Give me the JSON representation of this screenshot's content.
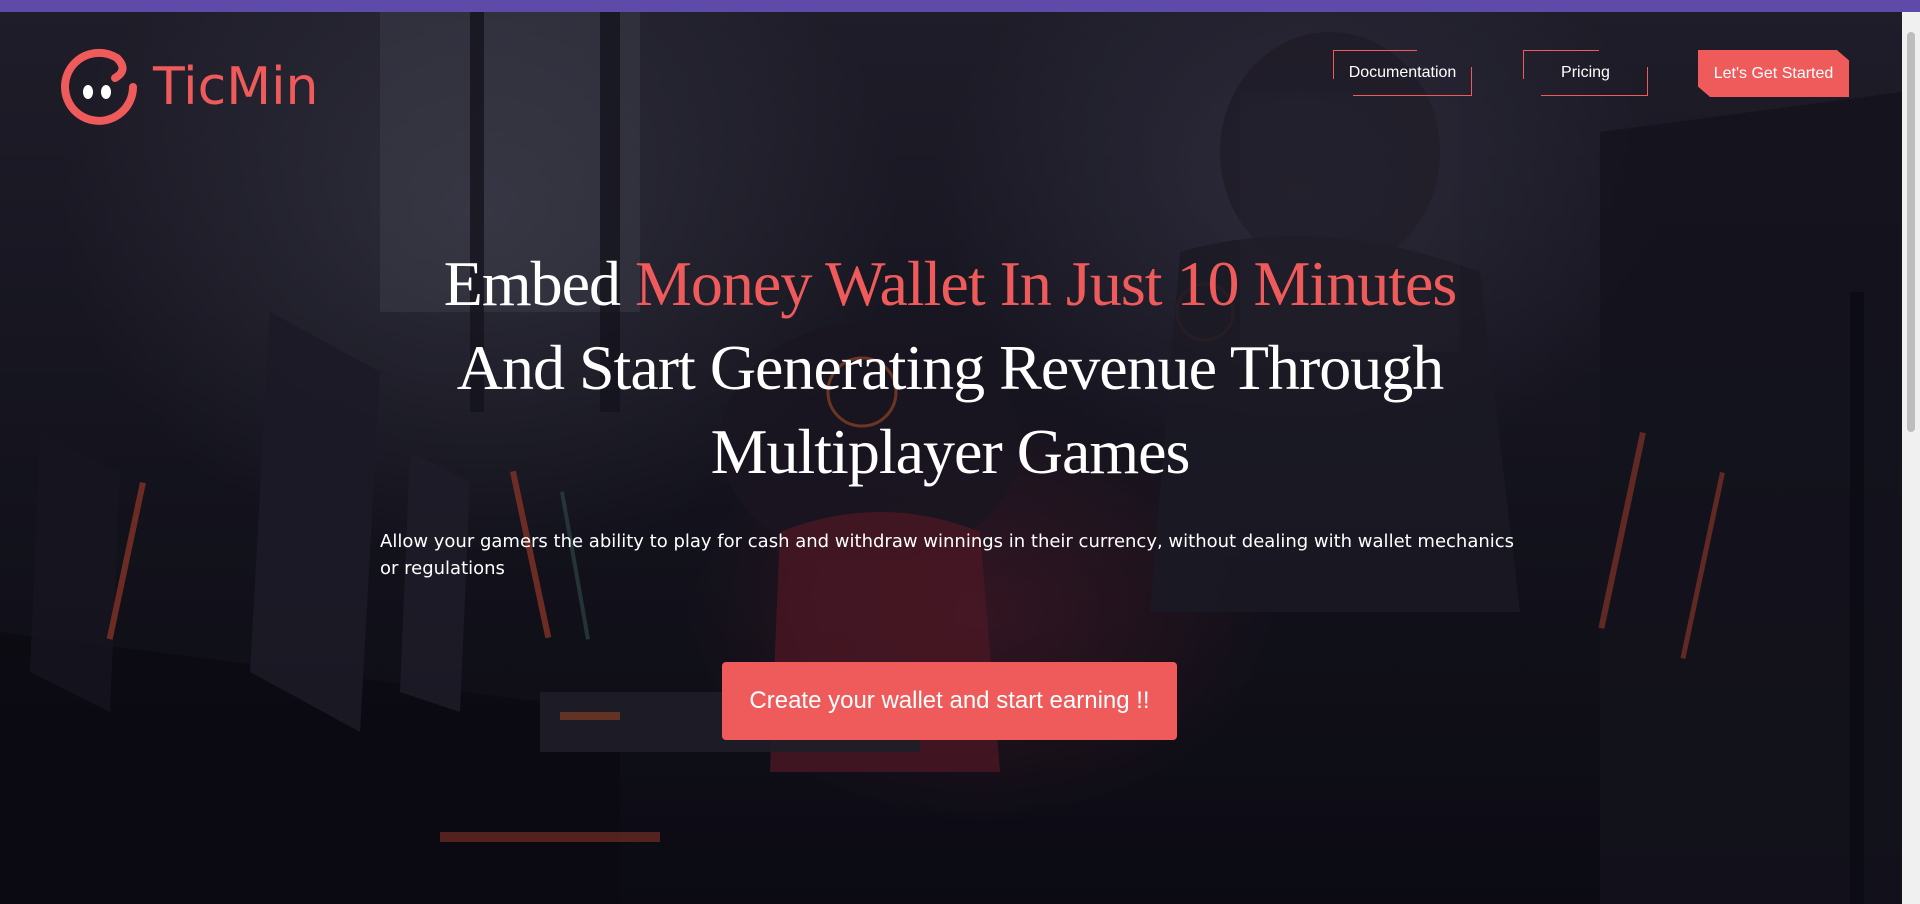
{
  "brand": {
    "name": "TicMin",
    "accent_color": "#ef5b5b",
    "topbar_color": "#5e4aa8",
    "logo_icon": "ticmin-face-logo-icon"
  },
  "nav": {
    "documentation": "Documentation",
    "pricing": "Pricing",
    "cta": "Let's Get Started"
  },
  "hero": {
    "headline_lead": "Embed ",
    "headline_accent": "Money Wallet In Just 10 Minutes",
    "headline_rest": "And Start Generating Revenue Through Multiplayer Games",
    "subtext": "Allow your gamers the ability to play for cash and withdraw winnings in their currency, without dealing with wallet mechanics or regulations",
    "cta": "Create your wallet and start earning !!",
    "background": "dark gaming room photo with player at laptop"
  }
}
